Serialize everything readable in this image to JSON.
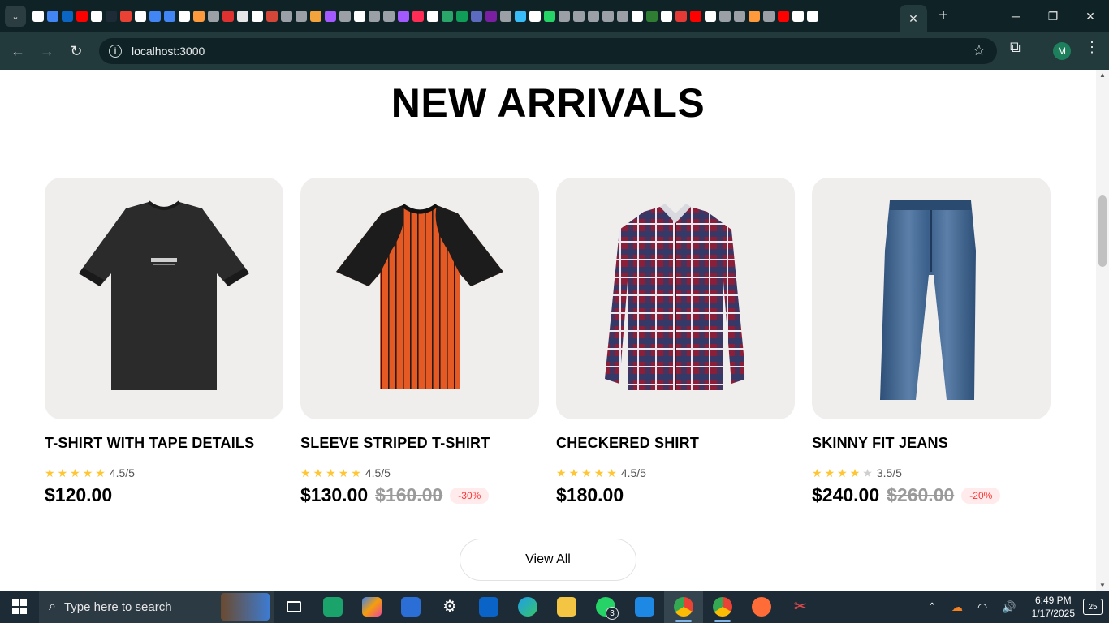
{
  "browser": {
    "address": "localhost:3000",
    "profile_initial": "M",
    "tab_close": "✕",
    "new_tab": "+",
    "minimize": "─",
    "restore": "❐",
    "close": "✕",
    "back": "←",
    "forward": "→",
    "reload": "↻",
    "star": "☆",
    "extensions": "⧉",
    "menu": "⋮",
    "tab_search": "⌄",
    "pinned_tab_colors": [
      "#ffffff",
      "#4285f4",
      "#0a66c2",
      "#ff0000",
      "#ffffff",
      "#1c2b36",
      "#e94235",
      "#ffffff",
      "#4285f4",
      "#4285f4",
      "#ffffff",
      "#ff9a3c",
      "#9aa0a6",
      "#e03131",
      "#e6e6e6",
      "#ffffff",
      "#d44638",
      "#9aa0a6",
      "#9aa0a6",
      "#f2a33c",
      "#a259ff",
      "#9aa0a6",
      "#ffffff",
      "#9aa0a6",
      "#9aa0a6",
      "#a259ff",
      "#ff2d55",
      "#ffffff",
      "#2ba66a",
      "#0f9d58",
      "#5c6bc0",
      "#7b1fa2",
      "#9aa0a6",
      "#38bdf8",
      "#ffffff",
      "#25d366",
      "#9aa0a6",
      "#9aa0a6",
      "#9aa0a6",
      "#9aa0a6",
      "#9aa0a6",
      "#ffffff",
      "#2e7d32",
      "#ffffff",
      "#e53935",
      "#ff0000",
      "#ffffff",
      "#9aa0a6",
      "#9aa0a6",
      "#ff9a3c",
      "#9aa0a6",
      "#ff0000",
      "#ffffff",
      "#ffffff"
    ]
  },
  "section": {
    "title": "NEW ARRIVALS"
  },
  "products": [
    {
      "name": "T-SHIRT WITH TAPE DETAILS",
      "rating": 4.5,
      "rating_text": "4.5/5",
      "price": "$120.00",
      "old_price": "",
      "discount": ""
    },
    {
      "name": "SLEEVE STRIPED T-SHIRT",
      "rating": 4.5,
      "rating_text": "4.5/5",
      "price": "$130.00",
      "old_price": "$160.00",
      "discount": "-30%"
    },
    {
      "name": "CHECKERED SHIRT",
      "rating": 4.5,
      "rating_text": "4.5/5",
      "price": "$180.00",
      "old_price": "",
      "discount": ""
    },
    {
      "name": "SKINNY FIT JEANS",
      "rating": 3.5,
      "rating_text": "3.5/5",
      "price": "$240.00",
      "old_price": "$260.00",
      "discount": "-20%"
    }
  ],
  "view_all_label": "View All",
  "taskbar": {
    "search_placeholder": "Type here to search",
    "whatsapp_badge": "3",
    "time": "6:49 PM",
    "date": "1/17/2025",
    "notification_count": "25"
  },
  "colors": {
    "star_filled": "#ffc633",
    "discount_text": "#ff3333",
    "discount_bg": "#ffebeb",
    "card_bg": "#f0eeed"
  }
}
